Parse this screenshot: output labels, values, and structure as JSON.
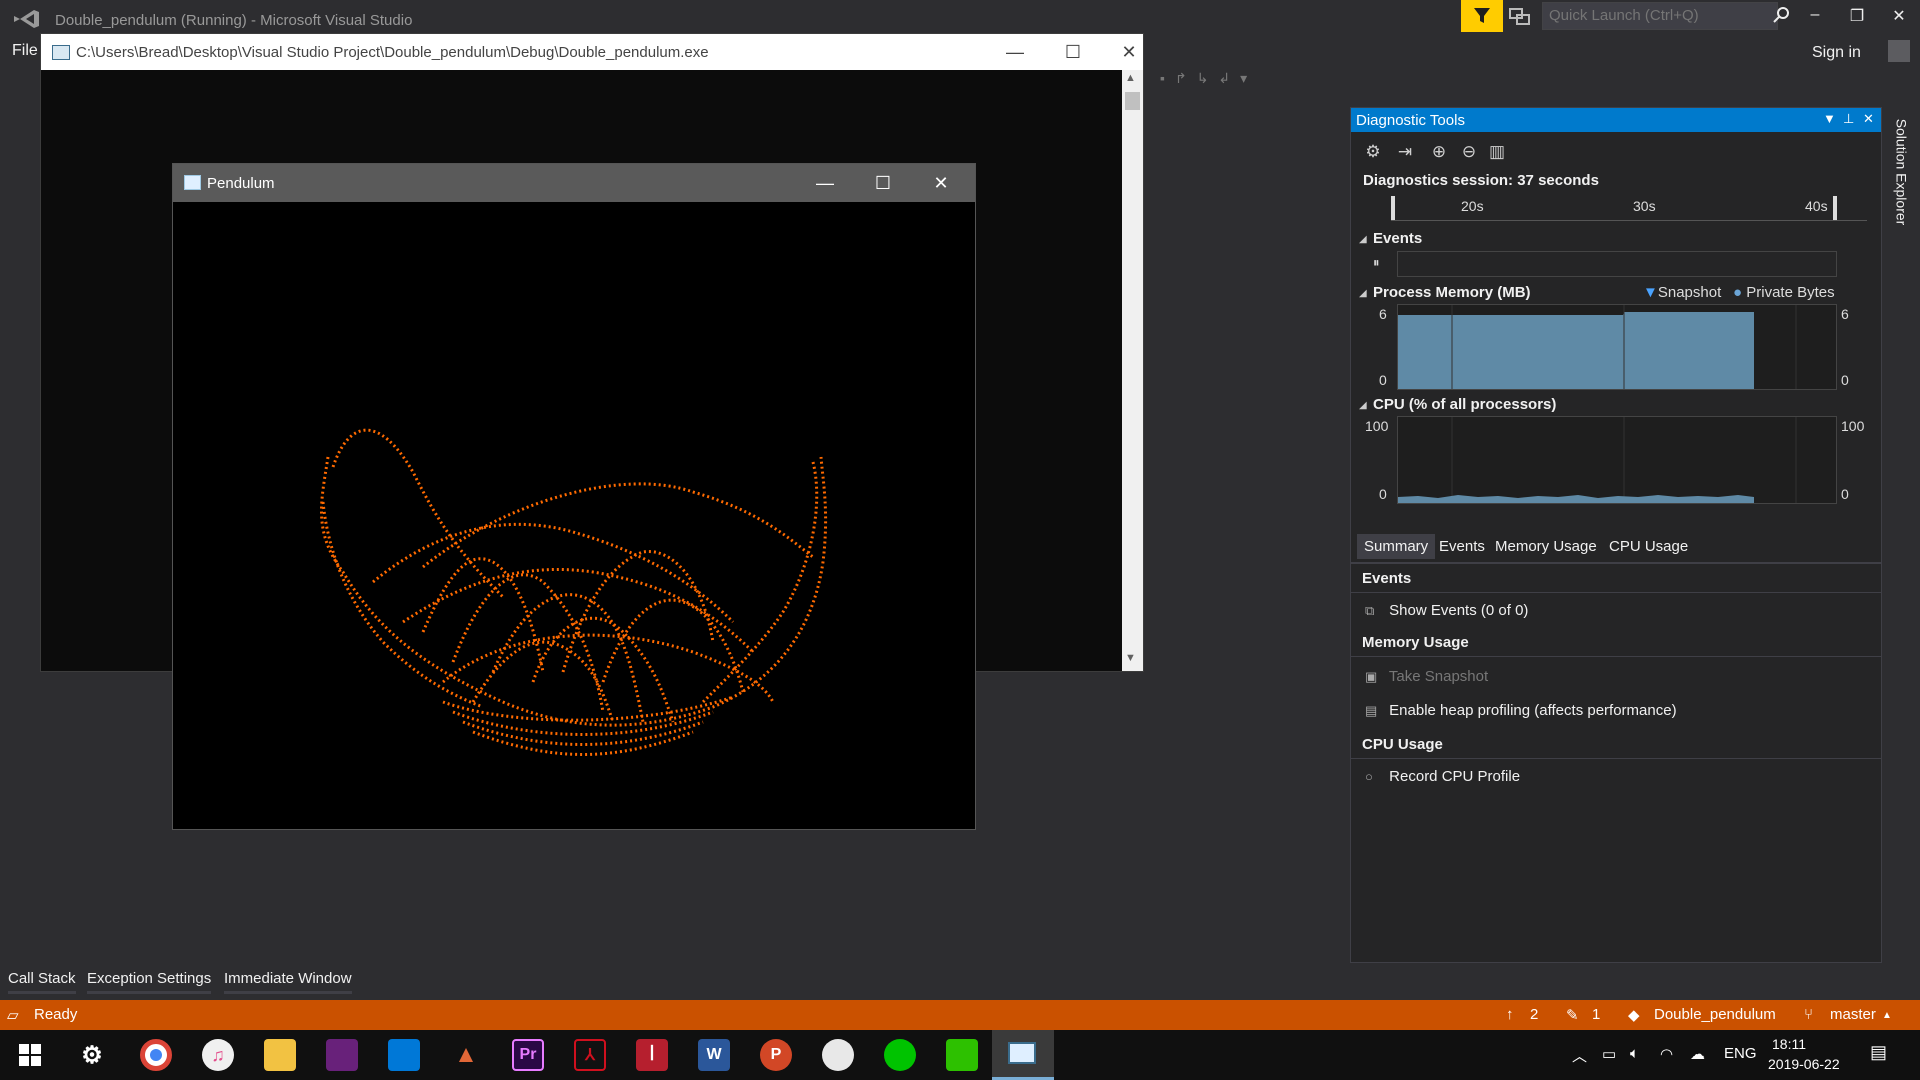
{
  "vs": {
    "title": "Double_pendulum (Running) - Microsoft Visual Studio",
    "quick_launch_placeholder": "Quick Launch (Ctrl+Q)",
    "menu_file": "File",
    "sign_in": "Sign in",
    "minimize": "–",
    "restore": "❐",
    "close": "✕"
  },
  "console": {
    "title": "C:\\Users\\Bread\\Desktop\\Visual Studio Project\\Double_pendulum\\Debug\\Double_pendulum.exe",
    "minimize": "—",
    "maximize": "☐",
    "close": "✕"
  },
  "pendulum": {
    "title": "Pendulum",
    "minimize": "—",
    "maximize": "☐",
    "close": "✕",
    "trace_color": "#ff6a00"
  },
  "diagnostic": {
    "title": "Diagnostic Tools",
    "session": "Diagnostics session: 37 seconds",
    "ruler_labels": [
      "20s",
      "30s",
      "40s"
    ],
    "events_label": "Events",
    "memory_label": "Process Memory (MB)",
    "legend_snapshot": "Snapshot",
    "legend_private": "Private Bytes",
    "memory_axis": {
      "max": "6",
      "min": "0"
    },
    "cpu_label": "CPU (% of all processors)",
    "cpu_axis": {
      "max": "100",
      "min": "0"
    },
    "tabs": [
      "Summary",
      "Events",
      "Memory Usage",
      "CPU Usage"
    ],
    "summary": {
      "events_head": "Events",
      "show_events": "Show Events (0 of 0)",
      "memory_head": "Memory Usage",
      "take_snapshot": "Take Snapshot",
      "heap_profiling": "Enable heap profiling (affects performance)",
      "cpu_head": "CPU Usage",
      "record_cpu": "Record CPU Profile"
    },
    "accent": "#007acc",
    "chart_fill": "#5f8aa6"
  },
  "solution_explorer": "Solution Explorer",
  "bottom_tabs": [
    "Call Stack",
    "Exception Settings",
    "Immediate Window"
  ],
  "status": {
    "ready": "Ready",
    "push_count": "2",
    "pending_count": "1",
    "repo": "Double_pendulum",
    "branch": "master",
    "color": "#ca5100"
  },
  "taskbar": {
    "time": "18:11",
    "date": "2019-06-22",
    "lang": "ENG",
    "apps": [
      "start-icon",
      "settings-icon",
      "chrome-icon",
      "itunes-icon",
      "file-explorer-icon",
      "visual-studio-icon",
      "vscode-icon",
      "matlab-icon",
      "premiere-icon",
      "acrobat-icon",
      "mendeley-icon",
      "word-icon",
      "powerpoint-icon",
      "paint-icon",
      "line-icon",
      "wechat-icon",
      "pendulum-app-icon"
    ],
    "premiere_label": "Pr",
    "word_label": "W",
    "powerpoint_label": "P"
  }
}
